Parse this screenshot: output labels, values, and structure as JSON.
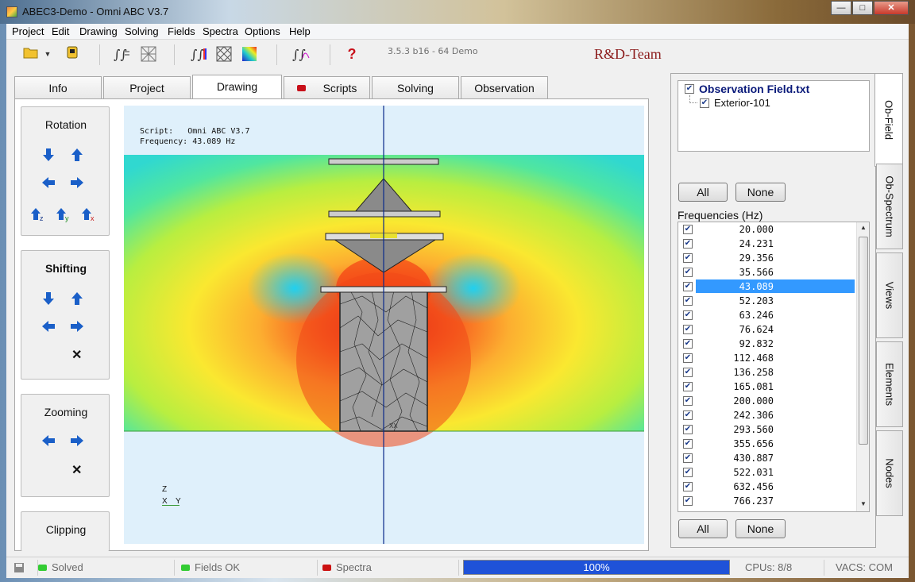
{
  "window": {
    "title": "ABEC3-Demo - Omni ABC V3.7",
    "btn_min": "—",
    "btn_max": "□",
    "btn_close": "✕"
  },
  "menu": [
    "Project",
    "Edit",
    "Drawing",
    "Solving",
    "Fields",
    "Spectra",
    "Options",
    "Help"
  ],
  "toolbar": {
    "version": "3.5.3 b16 - 64 Demo",
    "brand": "R&D-Team",
    "help_glyph": "?"
  },
  "tabs": [
    "Info",
    "Project",
    "Drawing",
    "Scripts",
    "Solving",
    "Observation"
  ],
  "controls": {
    "rotation": "Rotation",
    "shifting": "Shifting",
    "zooming": "Zooming",
    "clipping": "Clipping",
    "reset_glyph": "✕",
    "axis_z": "z",
    "axis_y": "y",
    "axis_x": "x"
  },
  "viewport": {
    "script_line": "Script:   Omni ABC V3.7",
    "freq_line": "Frequency: 43.089 Hz",
    "triad_z": "Z",
    "triad_x": "X",
    "triad_y": "Y",
    "mesh_id": "XX"
  },
  "observation": {
    "file": "Observation Field.txt",
    "child": "Exterior-101",
    "all_btn": "All",
    "none_btn": "None",
    "freq_label": "Frequencies  (Hz)",
    "frequencies": [
      "20.000",
      "24.231",
      "29.356",
      "35.566",
      "43.089",
      "52.203",
      "63.246",
      "76.624",
      "92.832",
      "112.468",
      "136.258",
      "165.081",
      "200.000",
      "242.306",
      "293.560",
      "355.656",
      "430.887",
      "522.031",
      "632.456",
      "766.237"
    ],
    "selected_index": 4,
    "all_btn2": "All",
    "none_btn2": "None"
  },
  "side_tabs": [
    "Ob-Field",
    "Ob-Spectrum",
    "Views",
    "Elements",
    "Nodes"
  ],
  "status": {
    "solved": "Solved",
    "fields": "Fields OK",
    "spectra": "Spectra",
    "progress": "100%",
    "progress_value": 1.0,
    "cpus": "CPUs: 8/8",
    "vacs": "VACS: COM"
  },
  "colors": {
    "green_led": "#33cc33",
    "red_led": "#cc1111",
    "progress": "#1f52d8",
    "selection": "#3399ff",
    "brand": "#8b1a1a"
  }
}
